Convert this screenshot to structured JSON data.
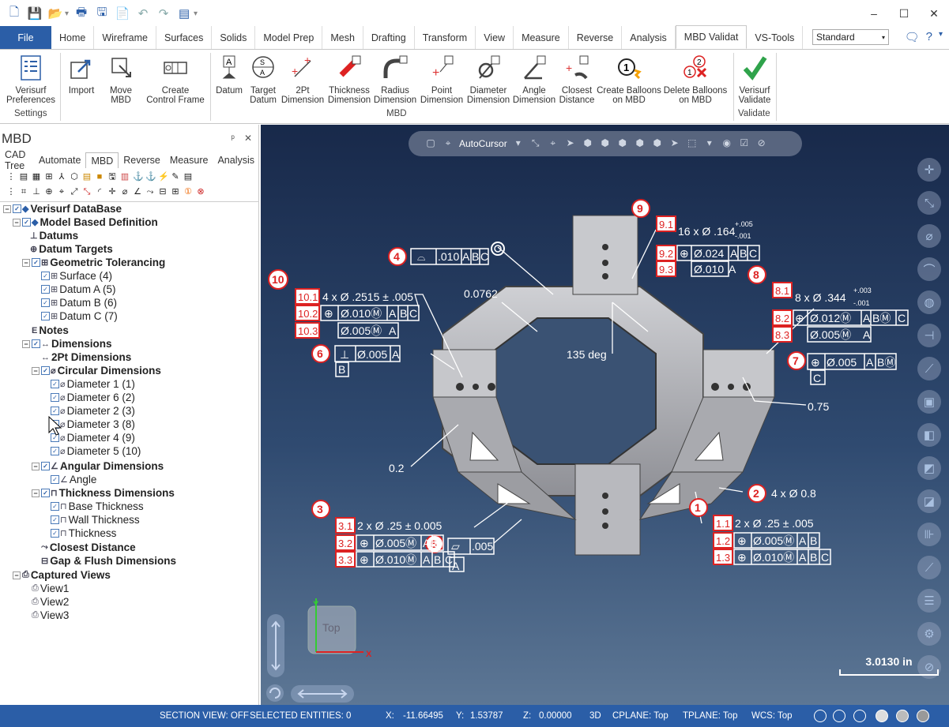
{
  "title_bar": {
    "quick_access": [
      "new-icon",
      "save-icon",
      "open-icon",
      "print-icon",
      "save-as-icon",
      "import-icon",
      "undo-icon",
      "redo-icon",
      "view-icon"
    ],
    "minimize": "–",
    "maximize": "☐",
    "close": "✕"
  },
  "ribbon_tabs": [
    "File",
    "Home",
    "Wireframe",
    "Surfaces",
    "Solids",
    "Model Prep",
    "Mesh",
    "Drafting",
    "Transform",
    "View",
    "Measure",
    "Reverse",
    "Analysis",
    "MBD Validat",
    "VS-Tools"
  ],
  "active_tab": "MBD Validat",
  "style_select": "Standard",
  "ribbon": {
    "buttons": [
      {
        "label1": "Verisurf",
        "label2": "Preferences"
      },
      {
        "label1": "Import",
        "label2": ""
      },
      {
        "label1": "Move",
        "label2": "MBD"
      },
      {
        "label1": "Create",
        "label2": "Control Frame"
      },
      {
        "label1": "Datum",
        "label2": ""
      },
      {
        "label1": "Target",
        "label2": "Datum"
      },
      {
        "label1": "2Pt",
        "label2": "Dimension"
      },
      {
        "label1": "Thickness",
        "label2": "Dimension"
      },
      {
        "label1": "Radius",
        "label2": "Dimension"
      },
      {
        "label1": "Point",
        "label2": "Dimension"
      },
      {
        "label1": "Diameter",
        "label2": "Dimension"
      },
      {
        "label1": "Angle",
        "label2": "Dimension"
      },
      {
        "label1": "Closest",
        "label2": "Distance"
      },
      {
        "label1": "Create Balloons",
        "label2": "on MBD"
      },
      {
        "label1": "Delete Balloons",
        "label2": "on MBD"
      },
      {
        "label1": "Verisurf",
        "label2": "Validate"
      }
    ],
    "groups": [
      "Settings",
      "MBD",
      "Validate"
    ]
  },
  "panel": {
    "title": "MBD",
    "pin": "ᵖ",
    "close": "✕",
    "tabs": [
      "CAD Tree",
      "Automate",
      "MBD",
      "Reverse",
      "Measure",
      "Analysis"
    ],
    "active_tab": "MBD",
    "tree": [
      "Verisurf DataBase",
      "Model Based Definition",
      "Datums",
      "Datum Targets",
      "Geometric Tolerancing",
      "Surface (4)",
      "Datum A (5)",
      "Datum B (6)",
      "Datum C (7)",
      "Notes",
      "Dimensions",
      "2Pt Dimensions",
      "Circular Dimensions",
      "Diameter 1 (1)",
      "Diameter 6 (2)",
      "Diameter 2 (3)",
      "Diameter 3 (8)",
      "Diameter 4 (9)",
      "Diameter 5 (10)",
      "Angular Dimensions",
      "Angle",
      "Thickness Dimensions",
      "Base Thickness",
      "Wall Thickness",
      "Thickness",
      "Closest Distance",
      "Gap & Flush Dimensions",
      "Captured Views",
      "View1",
      "View2",
      "View3"
    ]
  },
  "viewport": {
    "toolbar_label": "AutoCursor",
    "scale": "3.0130 in",
    "cube_label": "Top",
    "axis_x": "X",
    "axis_y": "Y",
    "annotations": {
      "b9_text": "16 x Ø .164",
      "b9_tol_plus": "+.005",
      "b9_tol_minus": "-.001",
      "b9_fcf1": "Ø.024",
      "b9_fcf2": "Ø.010",
      "b10_text": "4 x Ø .2515 ± .005",
      "b10_fcf1": "Ø.010Ⓜ",
      "b10_fcf2": "Ø.005Ⓜ",
      "b4_val": ".010",
      "b8_text": "8 x Ø .344",
      "b8_tol_plus": "+.003",
      "b8_tol_minus": "-.001",
      "b8_fcf1": "Ø.012Ⓜ",
      "b8_fcf2": "Ø.005Ⓜ",
      "dim_0762": "0.0762",
      "dim_135": "135 deg",
      "b6_val": "Ø.005",
      "b7_val": "Ø.005",
      "dim_075": "0.75",
      "dim_02": "0.2",
      "b2_text": "4 x Ø 0.8",
      "b3_text": "2 x Ø .25 ± 0.005",
      "b3_fcf1": "Ø.005Ⓜ",
      "b3_fcf2": "Ø.010Ⓜ",
      "b5_val": ".005",
      "b1_text": "2 x Ø .25 ± .005",
      "b1_fcf1": "Ø.005Ⓜ",
      "b1_fcf2": "Ø.010Ⓜ"
    }
  },
  "status": {
    "section_view": "SECTION VIEW: OFF",
    "selected": "SELECTED ENTITIES: 0",
    "x_label": "X:",
    "x_val": "-11.66495",
    "y_label": "Y:",
    "y_val": "1.53787",
    "z_label": "Z:",
    "z_val": "0.00000",
    "mode": "3D",
    "cplane": "CPLANE: Top",
    "tplane": "TPLANE: Top",
    "wcs": "WCS: Top"
  }
}
